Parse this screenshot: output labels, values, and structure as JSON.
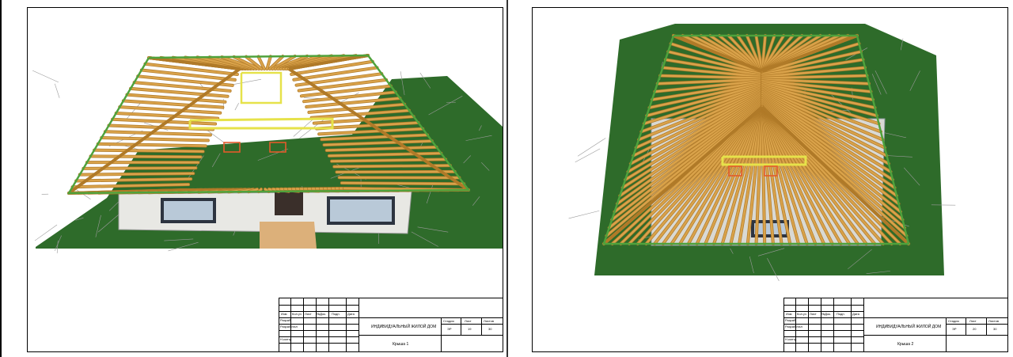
{
  "sheets": [
    {
      "name": "sheet-1",
      "title_block": {
        "cols": [
          "Изм",
          "Кол.уч",
          "Лист",
          "№Док.",
          "Подп.",
          "Дата"
        ],
        "rows": [
          "Разраб.",
          "Разработал",
          "Н.контр."
        ],
        "project": "ИНДИВИДУАЛЬНЫЙ ЖИЛОЙ ДОМ",
        "stage_label": "Стадия",
        "sheet_label": "Лист",
        "sheets_label": "Листов",
        "stage": "ЭР",
        "sheet": "19",
        "sheets": "30",
        "drawing": "Крыша 1"
      }
    },
    {
      "name": "sheet-2",
      "title_block": {
        "cols": [
          "Изм",
          "Кол.уч",
          "Лист",
          "№Док.",
          "Подп.",
          "Дата"
        ],
        "rows": [
          "Разраб.",
          "Разработал",
          "Н.контр."
        ],
        "project": "ИНДИВИДУАЛЬНЫЙ ЖИЛОЙ ДОМ",
        "stage_label": "Стадия",
        "sheet_label": "Лист",
        "sheets_label": "Листов",
        "stage": "ЭР",
        "sheet": "20",
        "sheets": "30",
        "drawing": "Крыша 2"
      }
    }
  ],
  "colors": {
    "terrain": "#2e6b2a",
    "terrain_mesh": "#9a9a9a",
    "rafter": "#d9a24a",
    "rafter_edge": "#b07a28",
    "wall": "#e8e8e4",
    "plate": "#4fa23c",
    "highlight": "#e6e24a",
    "accent": "#e35a2a"
  }
}
